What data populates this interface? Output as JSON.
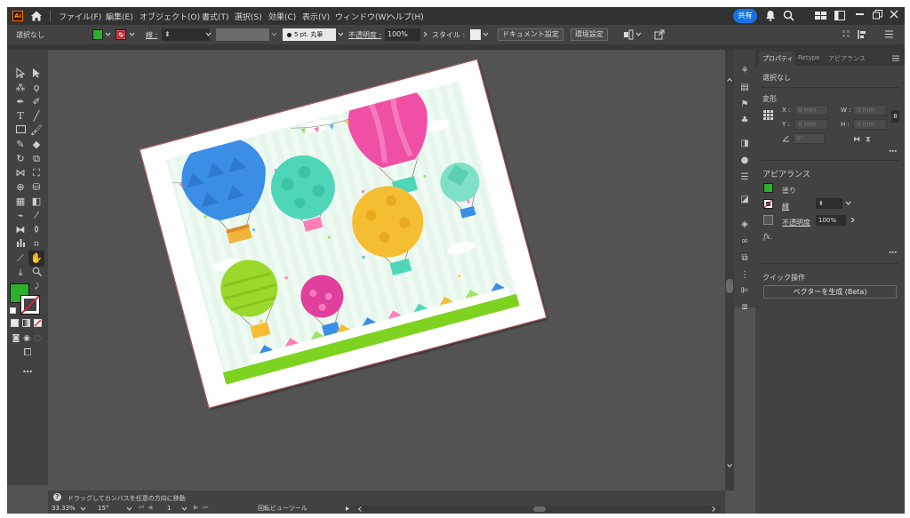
{
  "menubar": {
    "app_logo": "Ai",
    "menus": [
      "ファイル(F)",
      "編集(E)",
      "オブジェクト(O)",
      "書式(T)",
      "選択(S)",
      "効果(C)",
      "表示(V)",
      "ウィンドウ(W)",
      "ヘルプ(H)"
    ],
    "share_label": "共有",
    "window_controls": [
      "minimize-icon",
      "restore-icon",
      "close-icon"
    ]
  },
  "controlbar": {
    "selection_label": "選択なし",
    "stroke_label": "線 :",
    "stroke_style": "5 pt. 丸筆",
    "opacity_label": "不透明度 :",
    "opacity_value": "100%",
    "style_label": "スタイル :",
    "document_setup_button": "ドキュメント設定",
    "preferences_button": "環境設定"
  },
  "panel": {
    "tabs": [
      "プロパティ",
      "Retype",
      "アピアランス"
    ],
    "no_selection": "選択なし",
    "transform_header": "変形",
    "x_label": "X :",
    "y_label": "Y :",
    "w_label": "W :",
    "h_label": "H :",
    "x_value": "0 mm",
    "y_value": "0 mm",
    "w_value": "0 mm",
    "h_value": "0 mm",
    "angle_value": "0°",
    "appearance_header": "アピアランス",
    "fill_label": "塗り",
    "stroke_label": "線",
    "opacity_label": "不透明度",
    "opacity_value": "100%",
    "fx_label": "fx.",
    "quick_actions_header": "クイック操作",
    "generate_vector_button": "ベクターを生成 (Beta)"
  },
  "status": {
    "hint": "ドラッグしてカンバスを任意の方向に移動",
    "zoom": "33.33%",
    "rotation": "15°",
    "artboard": "1",
    "view_mode": "回転ビューツール"
  },
  "colors": {
    "fill_swatch": "#2bb02b",
    "canvas_bg": "#535353",
    "panel_bg": "#424242",
    "share_blue": "#1473e6"
  }
}
